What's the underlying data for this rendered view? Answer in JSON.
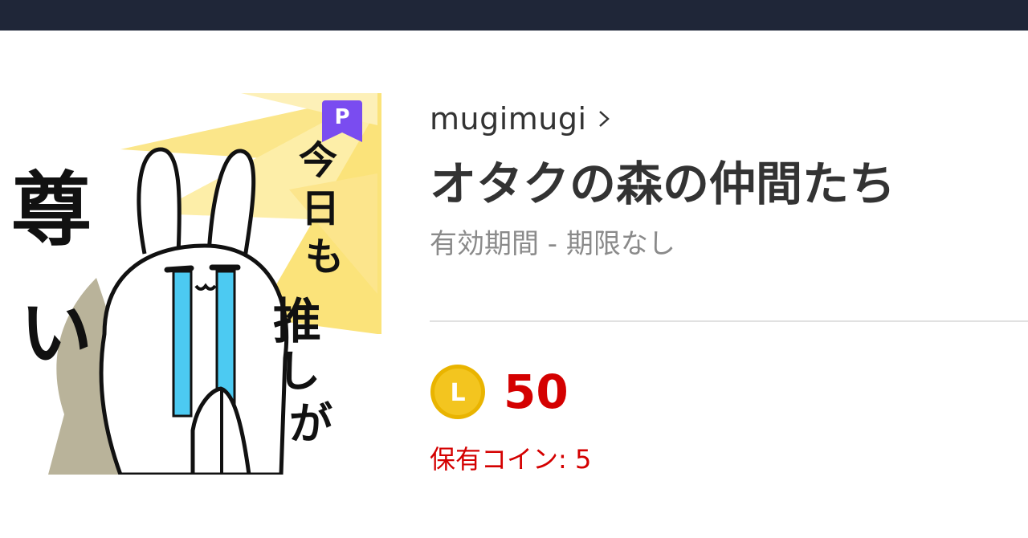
{
  "header": {
    "bar_color": "#1f2638"
  },
  "sticker": {
    "image_name": "crying-rabbit-sticker",
    "texts": [
      "尊い",
      "今日も推しが"
    ],
    "premium_badge_letter": "P",
    "premium_badge_color": "#7a4cf0"
  },
  "product": {
    "author": "mugimugi",
    "title": "オタクの森の仲間たち",
    "validity": "有効期間 - 期限なし"
  },
  "price": {
    "coin_icon": "line-coin-icon",
    "coin_letter": "L",
    "value": "50",
    "owned_coins": "保有コイン: 5"
  },
  "colors": {
    "price_red": "#d40000",
    "text_dark": "#333333",
    "text_gray": "#8a8a8a",
    "coin_gold": "#f3c51f"
  }
}
